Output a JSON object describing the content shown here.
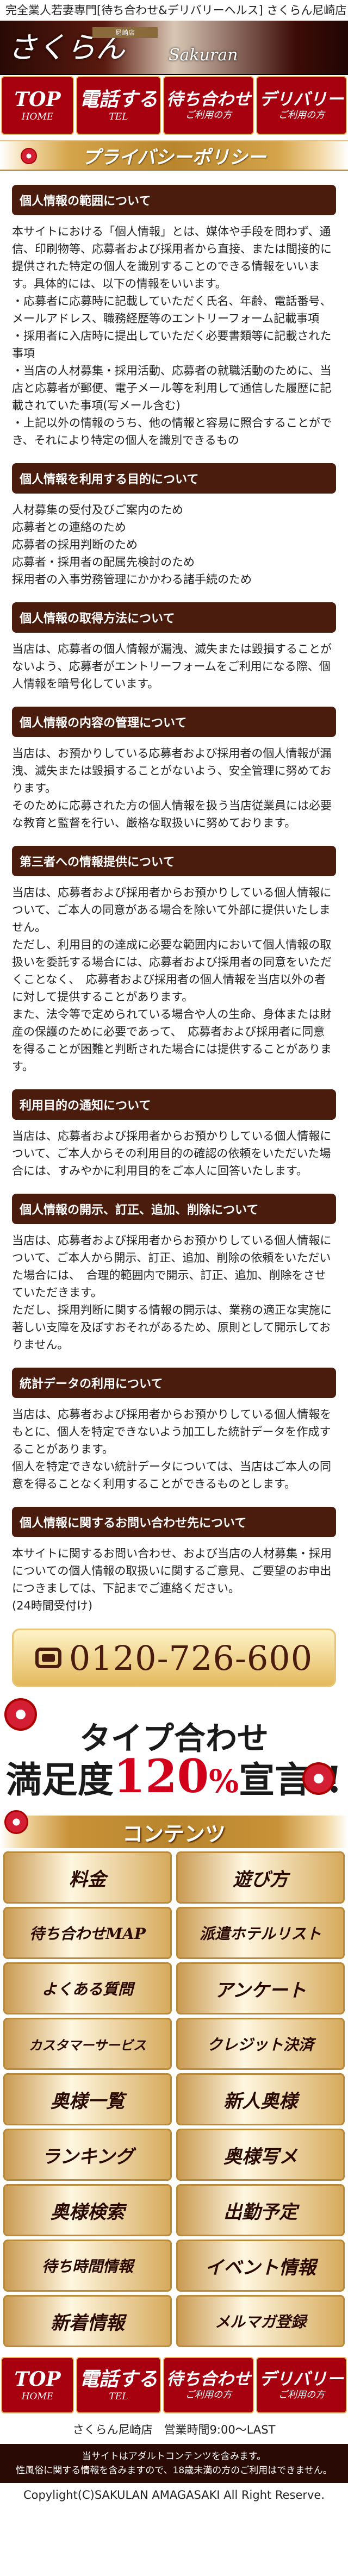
{
  "top_line": "完全業人若妻専門[待ち合わせ&デリバリーヘルス] さくらん尼崎店",
  "header": {
    "logo": "さくらん",
    "tag": "尼崎店",
    "sub": "Sakuran"
  },
  "nav": [
    {
      "main": "TOP",
      "sub": "HOME"
    },
    {
      "main": "電話する",
      "sub": "TEL"
    },
    {
      "main": "待ち合わせ",
      "sub": "ご利用の方"
    },
    {
      "main": "デリバリー",
      "sub": "ご利用の方"
    }
  ],
  "privacy": {
    "title": "プライバシーポリシー",
    "sections": [
      {
        "heading": "個人情報の範囲について",
        "body": "本サイトにおける「個人情報」とは、媒体や手段を問わず、通信、印刷物等、応募者および採用者から直接、または間接的に提供された特定の個人を識別することのできる情報をいいます。具体的には、以下の情報をいいます。\n・応募者に応募時に記載していただく氏名、年齢、電話番号、メールアドレス、職務経歴等のエントリーフォーム記載事項\n・採用者に入店時に提出していただく必要書類等に記載された事項\n・当店の人材募集・採用活動、応募者の就職活動のために、当店と応募者が郵便、電子メール等を利用して通信した履歴に記載されていた事項(写メール含む)\n・上記以外の情報のうち、他の情報と容易に照合することができ、それにより特定の個人を識別できるもの"
      },
      {
        "heading": "個人情報を利用する目的について",
        "body": "人材募集の受付及びご案内のため\n応募者との連絡のため\n応募者の採用判断のため\n応募者・採用者の配属先検討のため\n採用者の入事労務管理にかかわる諸手続のため"
      },
      {
        "heading": "個人情報の取得方法について",
        "body": "当店は、応募者の個人情報が漏洩、滅失または毀損することがないよう、応募者がエントリーフォームをご利用になる際、個人情報を暗号化しています。"
      },
      {
        "heading": "個人情報の内容の管理について",
        "body": "当店は、お預かりしている応募者および採用者の個人情報が漏洩、滅失または毀損することがないよう、安全管理に努めております。\nそのために応募された方の個人情報を扱う当店従業員には必要な教育と監督を行い、厳格な取扱いに努めております。"
      },
      {
        "heading": "第三者への情報提供について",
        "body": "当店は、応募者および採用者からお預かりしている個人情報について、ご本人の同意がある場合を除いて外部に提供いたしません。\nただし、利用目的の達成に必要な範囲内において個人情報の取扱いを委託する場合には、応募者および採用者の同意をいただくことなく、　応募者および採用者の個人情報を当店以外の者に対して提供することがあります。\nまた、法令等で定められている場合や人の生命、身体または財産の保護のために必要であって、　応募者および採用者に同意を得ることが困難と判断された場合には提供することがあります。"
      },
      {
        "heading": "利用目的の通知について",
        "body": "当店は、応募者および採用者からお預かりしている個人情報について、ご本人からその利用目的の確認の依頼をいただいた場合には、すみやかに利用目的をご本人に回答いたします。"
      },
      {
        "heading": "個人情報の開示、訂正、追加、削除について",
        "body": "当店は、応募者および採用者からお預かりしている個人情報について、ご本人から開示、訂正、追加、削除の依頼をいただいた場合には、　合理的範囲内で開示、訂正、追加、削除をさせていただきます。\nただし、採用判断に関する情報の開示は、業務の適正な実施に著しい支障を及ぼすおそれがあるため、原則として開示しておりません。"
      },
      {
        "heading": "統計データの利用について",
        "body": "当店は、応募者および採用者からお預かりしている個人情報をもとに、個人を特定できないよう加工した統計データを作成することがあります。\n個人を特定できない統計データについては、当店はご本人の同意を得ることなく利用することができるものとします。"
      },
      {
        "heading": "個人情報に関するお問い合わせ先について",
        "body": "本サイトに関するお問い合わせ、および当店の人材募集・採用についての個人情報の取扱いに関するご意見、ご要望のお申出につきましては、下記までご連絡ください。\n(24時間受付け)"
      }
    ]
  },
  "phone": {
    "number": "0120-726-600"
  },
  "promo": {
    "line1": "タイプ合わせ",
    "line2_pre": "満足度",
    "line2_num": "120",
    "line2_pct": "%",
    "line2_post": "宣言!!"
  },
  "contents": {
    "title": "コンテンツ",
    "items": [
      "料金",
      "遊び方",
      "待ち合わせMAP",
      "派遣ホテルリスト",
      "よくある質問",
      "アンケート",
      "カスタマーサービス",
      "クレジット決済",
      "奥様一覧",
      "新人奥様",
      "ランキング",
      "奥様写メ",
      "奥様検索",
      "出勤予定",
      "待ち時間情報",
      "イベント情報",
      "新着情報",
      "メルマガ登録"
    ]
  },
  "footer": {
    "shop": "さくらん尼崎店　営業時間9:00～LAST",
    "notice1": "当サイトはアダルトコンテンツを含みます。",
    "notice2": "性風俗に関する情報を含みますので、18歳未満の方のご利用はできません。",
    "copyright": "Copylight(C)SAKULAN AMAGASAKI All Right Reserve."
  }
}
